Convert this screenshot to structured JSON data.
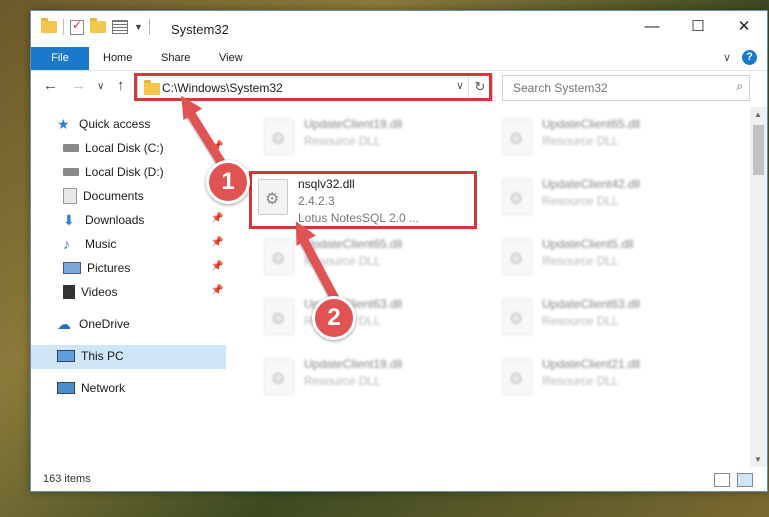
{
  "window": {
    "title": "System32",
    "minimize_glyph": "—",
    "maximize_glyph": "☐",
    "close_glyph": "✕"
  },
  "ribbon": {
    "tabs": [
      {
        "label": "File"
      },
      {
        "label": "Home"
      },
      {
        "label": "Share"
      },
      {
        "label": "View"
      }
    ],
    "help_glyph": "?",
    "collapse_glyph": "∨"
  },
  "navbar": {
    "back_glyph": "←",
    "forward_glyph": "→",
    "recent_glyph": "∨",
    "up_glyph": "↑",
    "address_path": "C:\\Windows\\System32",
    "refresh_glyph": "↻",
    "search_placeholder": "Search System32"
  },
  "sidebar": {
    "items": [
      {
        "label": "Quick access",
        "icon": "star-icon"
      },
      {
        "label": "Local Disk (C:)",
        "icon": "drive-icon"
      },
      {
        "label": "Local Disk (D:)",
        "icon": "drive-icon"
      },
      {
        "label": "Documents",
        "icon": "documents-icon"
      },
      {
        "label": "Downloads",
        "icon": "downloads-icon"
      },
      {
        "label": "Music",
        "icon": "music-icon"
      },
      {
        "label": "Pictures",
        "icon": "pictures-icon"
      },
      {
        "label": "Videos",
        "icon": "videos-icon"
      },
      {
        "label": "OneDrive",
        "icon": "cloud-icon"
      },
      {
        "label": "This PC",
        "icon": "computer-icon"
      },
      {
        "label": "Network",
        "icon": "network-icon"
      }
    ]
  },
  "files": [
    {
      "name": "UpdateClient19.dll",
      "line1": "Resource DLL",
      "line2": ""
    },
    {
      "name": "UpdateClient65.dll",
      "line1": "Resource DLL",
      "line2": ""
    },
    {
      "name": "nsqlv32.dll",
      "line1": "2.4.2.3",
      "line2": "Lotus NotesSQL 2.0 ..."
    },
    {
      "name": "UpdateClient42.dll",
      "line1": "Resource DLL",
      "line2": ""
    },
    {
      "name": "UpdateClient65.dll",
      "line1": "Resource DLL",
      "line2": ""
    },
    {
      "name": "UpdateClient5.dll",
      "line1": "Resource DLL",
      "line2": ""
    },
    {
      "name": "UpdateClient63.dll",
      "line1": "Resource DLL",
      "line2": ""
    },
    {
      "name": "UpdateClient63.dll",
      "line1": "Resource DLL",
      "line2": ""
    },
    {
      "name": "UpdateClient19.dll",
      "line1": "Resource DLL",
      "line2": ""
    },
    {
      "name": "UpdateClient21.dll",
      "line1": "Resource DLL",
      "line2": ""
    }
  ],
  "status": {
    "item_count": "163 items"
  },
  "annotations": {
    "step1": "1",
    "step2": "2",
    "color": "#e05353"
  }
}
